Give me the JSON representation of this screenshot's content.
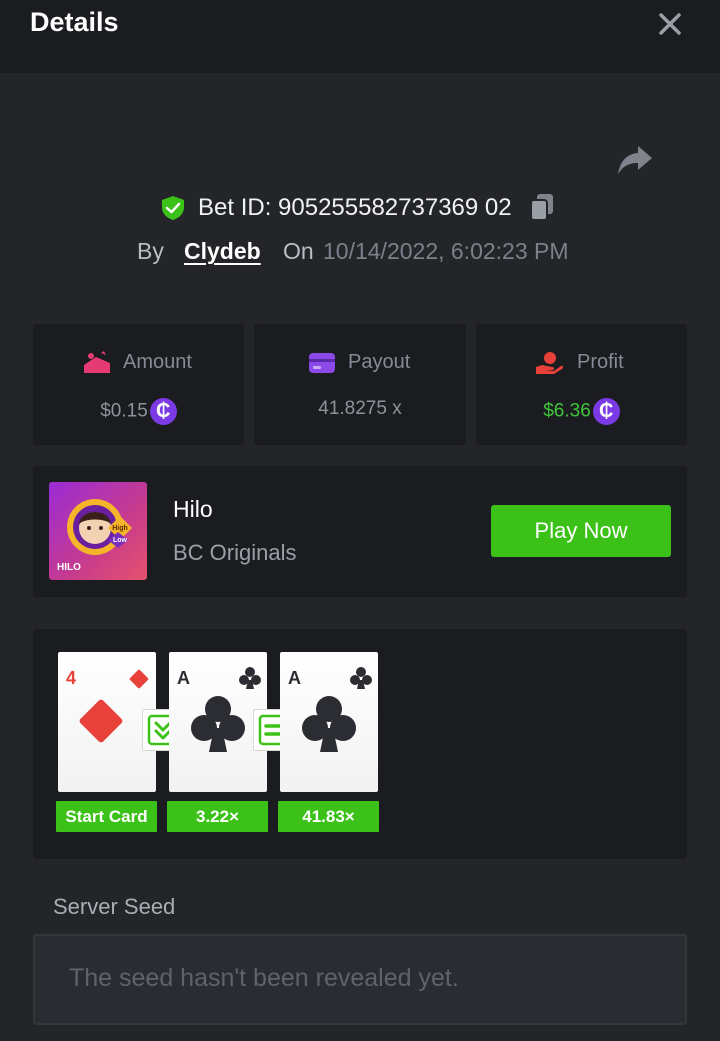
{
  "header": {
    "title": "Details"
  },
  "bet": {
    "id_text": "Bet ID: 905255582737369 02",
    "by_label": "By",
    "username": "Clydeb",
    "on_label": "On",
    "datetime": "10/14/2022, 6:02:23 PM"
  },
  "stats": [
    {
      "label": "Amount",
      "value": "$0.15",
      "icon": "bet-amount-icon"
    },
    {
      "label": "Payout",
      "value": "41.8275 x",
      "icon": "wallet-icon"
    },
    {
      "label": "Profit",
      "value": "$6.36",
      "icon": "profit-hand-icon"
    }
  ],
  "game": {
    "name": "Hilo",
    "provider": "BC Originals",
    "play_label": "Play Now",
    "thumb_label": "HILO",
    "thumb_high": "High",
    "thumb_low": "Low"
  },
  "cards": [
    {
      "rank": "4",
      "suit": "diamond",
      "label": "Start Card"
    },
    {
      "rank": "A",
      "suit": "club",
      "label": "3.22×"
    },
    {
      "rank": "A",
      "suit": "club",
      "label": "41.83×"
    }
  ],
  "seed": {
    "label": "Server Seed",
    "placeholder": "The seed hasn't been revealed yet."
  },
  "colors": {
    "accent_green": "#3bc117",
    "coin_purple": "#7c3ae7",
    "diamond_red": "#e8413a"
  }
}
